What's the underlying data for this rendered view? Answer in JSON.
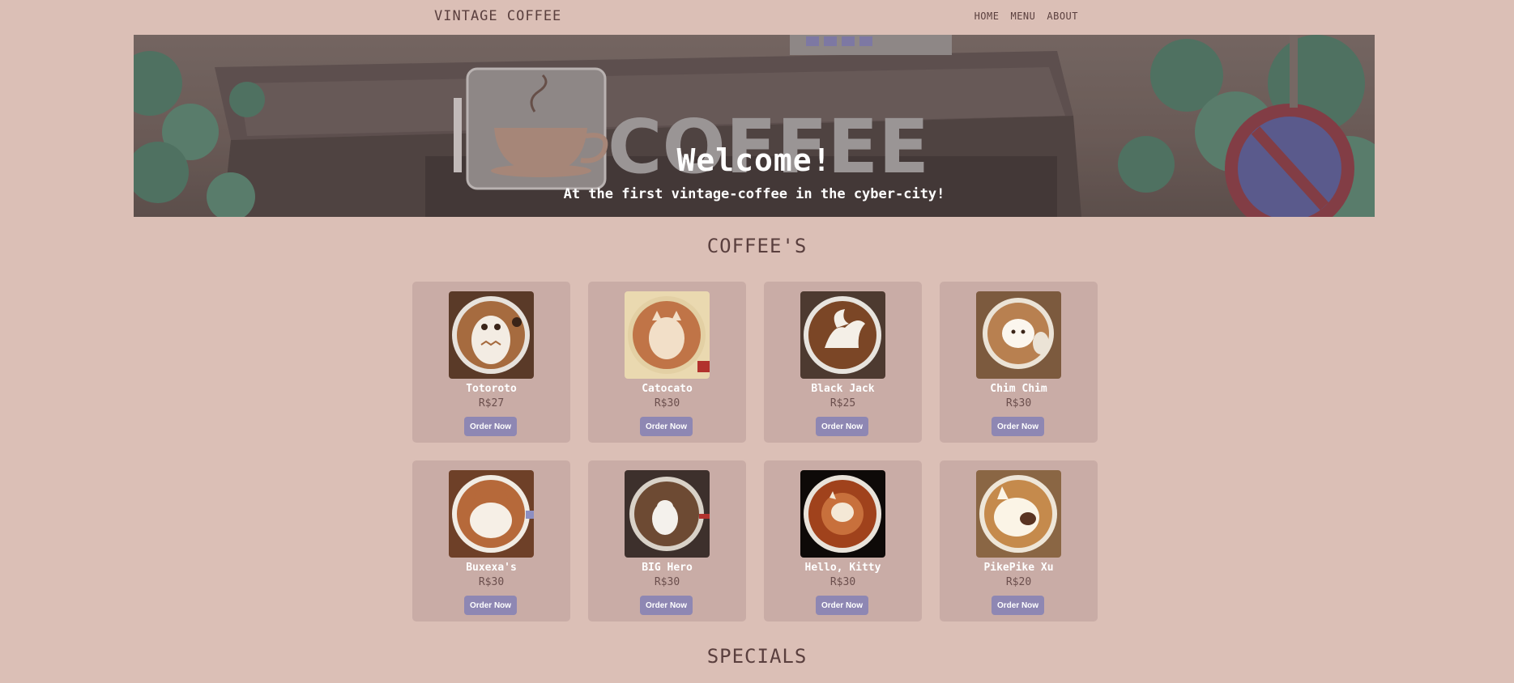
{
  "navbar": {
    "brand": "VINTAGE COFFEE",
    "links": [
      "HOME",
      "MENU",
      "ABOUT"
    ]
  },
  "hero": {
    "title": "Welcome!",
    "subtitle": "At the first vintage-coffee in the cyber-city!"
  },
  "coffees": {
    "title": "COFFEE'S",
    "items": [
      {
        "name": "Totoroto",
        "price": "R$27",
        "button": "Order Now",
        "icon": "totoro-latte-art"
      },
      {
        "name": "Catocato",
        "price": "R$30",
        "button": "Order Now",
        "icon": "cat-latte-art"
      },
      {
        "name": "Black Jack",
        "price": "R$25",
        "button": "Order Now",
        "icon": "pegasus-latte-art"
      },
      {
        "name": "Chim Chim",
        "price": "R$30",
        "button": "Order Now",
        "icon": "chick-latte-art"
      },
      {
        "name": "Buxexa's",
        "price": "R$30",
        "button": "Order Now",
        "icon": "shiba-latte-art"
      },
      {
        "name": "BIG Hero",
        "price": "R$30",
        "button": "Order Now",
        "icon": "baymax-latte-art"
      },
      {
        "name": "Hello, Kitty",
        "price": "R$30",
        "button": "Order Now",
        "icon": "kitty-latte-art"
      },
      {
        "name": "PikePike Xu",
        "price": "R$20",
        "button": "Order Now",
        "icon": "pig-latte-art"
      }
    ]
  },
  "specials": {
    "title": "SPECIALS"
  },
  "colors": {
    "background": "#dbbfb6",
    "card": "#c9aca6",
    "button": "#8e87b3",
    "text": "#5a3f3e"
  }
}
